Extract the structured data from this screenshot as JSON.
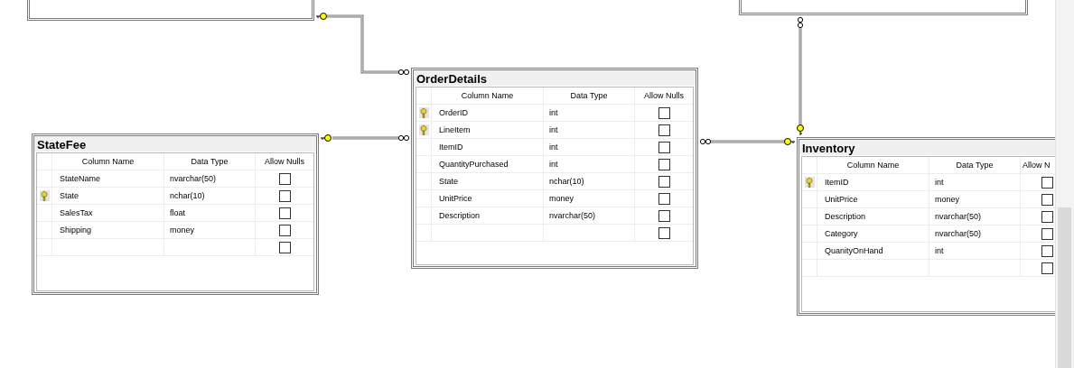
{
  "tables": [
    {
      "name": "StateFee",
      "headers": [
        "Column Name",
        "Data Type",
        "Allow Nulls"
      ],
      "rows": [
        {
          "kind": "column",
          "column_name": "StateName",
          "data_type": "nvarchar(50)",
          "primary_key": false,
          "allow_nulls": false
        },
        {
          "kind": "column",
          "column_name": "State",
          "data_type": "nchar(10)",
          "primary_key": true,
          "allow_nulls": false
        },
        {
          "kind": "column",
          "column_name": "SalesTax",
          "data_type": "float",
          "primary_key": false,
          "allow_nulls": false
        },
        {
          "kind": "column",
          "column_name": "Shipping",
          "data_type": "money",
          "primary_key": false,
          "allow_nulls": false
        },
        {
          "kind": "new",
          "allow_nulls": false
        }
      ]
    },
    {
      "name": "OrderDetails",
      "headers": [
        "Column Name",
        "Data Type",
        "Allow Nulls"
      ],
      "rows": [
        {
          "kind": "column",
          "column_name": "OrderID",
          "data_type": "int",
          "primary_key": true,
          "allow_nulls": false
        },
        {
          "kind": "column",
          "column_name": "LineItem",
          "data_type": "int",
          "primary_key": true,
          "allow_nulls": false
        },
        {
          "kind": "column",
          "column_name": "ItemID",
          "data_type": "int",
          "primary_key": false,
          "allow_nulls": false
        },
        {
          "kind": "column",
          "column_name": "QuantityPurchased",
          "data_type": "int",
          "primary_key": false,
          "allow_nulls": false
        },
        {
          "kind": "column",
          "column_name": "State",
          "data_type": "nchar(10)",
          "primary_key": false,
          "allow_nulls": false
        },
        {
          "kind": "column",
          "column_name": "UnitPrice",
          "data_type": "money",
          "primary_key": false,
          "allow_nulls": false
        },
        {
          "kind": "column",
          "column_name": "Description",
          "data_type": "nvarchar(50)",
          "primary_key": false,
          "allow_nulls": false
        },
        {
          "kind": "new",
          "allow_nulls": false
        }
      ]
    },
    {
      "name": "Inventory",
      "headers": [
        "Column Name",
        "Data Type",
        "Allow N"
      ],
      "rows": [
        {
          "kind": "column",
          "column_name": "ItemID",
          "data_type": "int",
          "primary_key": true,
          "allow_nulls": false
        },
        {
          "kind": "column",
          "column_name": "UnitPrice",
          "data_type": "money",
          "primary_key": false,
          "allow_nulls": false
        },
        {
          "kind": "column",
          "column_name": "Description",
          "data_type": "nvarchar(50)",
          "primary_key": false,
          "allow_nulls": false
        },
        {
          "kind": "column",
          "column_name": "Category",
          "data_type": "nvarchar(50)",
          "primary_key": false,
          "allow_nulls": false
        },
        {
          "kind": "column",
          "column_name": "QuanityOnHand",
          "data_type": "int",
          "primary_key": false,
          "allow_nulls": false
        },
        {
          "kind": "new",
          "allow_nulls": false
        }
      ]
    }
  ]
}
